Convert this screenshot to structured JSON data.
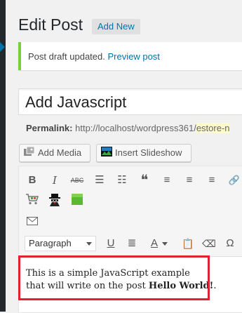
{
  "page": {
    "title": "Edit Post",
    "add_new_label": "Add New"
  },
  "notice": {
    "message": "Post draft updated.",
    "link_label": "Preview post",
    "accent_color": "#7ad03a"
  },
  "post": {
    "title": "Add Javascript",
    "permalink_label": "Permalink:",
    "permalink_base": "http://localhost/wordpress361/",
    "permalink_slug": "estore-n"
  },
  "media_buttons": {
    "add_media": "Add Media",
    "insert_slideshow": "Insert Slideshow"
  },
  "toolbar": {
    "row1_icons": [
      "bold-icon",
      "italic-icon",
      "strikethrough-icon",
      "bulleted-list-icon",
      "numbered-list-icon",
      "blockquote-icon",
      "align-left-icon",
      "align-center-icon",
      "align-right-icon",
      "link-icon"
    ],
    "row1_glyphs": [
      "B",
      "I",
      "ABC",
      "☰",
      "☷",
      "❝",
      "≡",
      "≡",
      "≡",
      "🔗"
    ],
    "row2_icons": [
      "shopping-cart-icon",
      "spy-icon",
      "green-square-icon"
    ],
    "row3_icons": [
      "envelope-icon"
    ],
    "format_select": "Paragraph",
    "row4_icons": [
      "underline-icon",
      "justify-icon",
      "text-color-icon",
      "paste-as-text-icon",
      "clear-formatting-icon",
      "special-character-icon"
    ],
    "row4_glyphs": [
      "U",
      "≣",
      "A",
      "📋",
      "⌫",
      "Ω"
    ]
  },
  "content": {
    "line1": "This is a simple JavaScript example",
    "line2_prefix": "that will write on the post ",
    "line2_bold": "Hello World!",
    "line2_suffix": "."
  },
  "colors": {
    "link": "#0073aa",
    "highlight_border": "#e02132"
  }
}
